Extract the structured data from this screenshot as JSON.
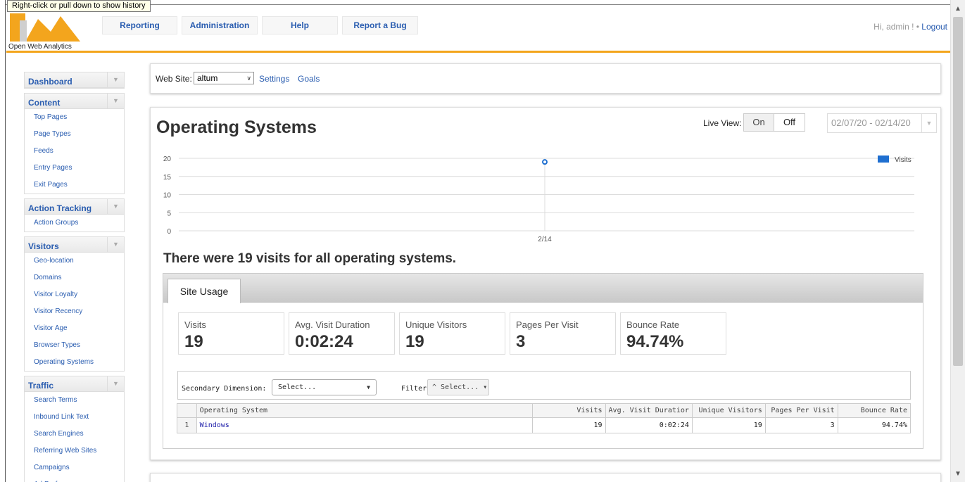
{
  "browser": {
    "tooltip": "Right-click or pull down to show history"
  },
  "header": {
    "logo_text": "Open Web Analytics",
    "nav": [
      {
        "label": "Reporting"
      },
      {
        "label": "Administration"
      },
      {
        "label": "Help"
      },
      {
        "label": "Report a Bug"
      }
    ],
    "greeting": "Hi, admin ! •",
    "logout": "Logout"
  },
  "sidebar": {
    "groups": [
      {
        "title": "Dashboard",
        "items": []
      },
      {
        "title": "Content",
        "items": [
          "Top Pages",
          "Page Types",
          "Feeds",
          "Entry Pages",
          "Exit Pages"
        ]
      },
      {
        "title": "Action Tracking",
        "items": [
          "Action Groups"
        ]
      },
      {
        "title": "Visitors",
        "items": [
          "Geo-location",
          "Domains",
          "Visitor Loyalty",
          "Visitor Recency",
          "Visitor Age",
          "Browser Types",
          "Operating Systems"
        ]
      },
      {
        "title": "Traffic",
        "items": [
          "Search Terms",
          "Inbound Link Text",
          "Search Engines",
          "Referring Web Sites",
          "Campaigns",
          "Ad Performance"
        ]
      }
    ]
  },
  "site_bar": {
    "label": "Web Site:",
    "selected": "altum",
    "settings": "Settings",
    "goals": "Goals"
  },
  "report": {
    "title": "Operating Systems",
    "live_view_label": "Live View:",
    "live_on": "On",
    "live_off": "Off",
    "date_range": "02/07/20 - 02/14/20",
    "summary": "There were 19 visits for all operating systems."
  },
  "chart_data": {
    "type": "line",
    "x": [
      "2/14"
    ],
    "series": [
      {
        "name": "Visits",
        "values": [
          19
        ]
      }
    ],
    "yticks": [
      0,
      5,
      10,
      15,
      20
    ],
    "ylim": [
      0,
      20
    ],
    "grid": true,
    "legend": "top-right",
    "color": "#1f6fd0"
  },
  "site_usage": {
    "tab": "Site Usage",
    "metrics": [
      {
        "label": "Visits",
        "value": "19"
      },
      {
        "label": "Avg. Visit Duration",
        "value": "0:02:24"
      },
      {
        "label": "Unique Visitors",
        "value": "19"
      },
      {
        "label": "Pages Per Visit",
        "value": "3"
      },
      {
        "label": "Bounce Rate",
        "value": "94.74%"
      }
    ]
  },
  "table": {
    "secondary_label": "Secondary Dimension:",
    "secondary_value": "Select...",
    "filter_label": "Filter:",
    "filter_value": "^ Select... ▾",
    "columns": [
      "Operating System",
      "Visits",
      "Avg. Visit Duratior",
      "Unique Visitors",
      "Pages Per Visit",
      "Bounce Rate"
    ],
    "rows": [
      {
        "n": "1",
        "os": "Windows",
        "visits": "19",
        "duration": "0:02:24",
        "unique": "19",
        "ppv": "3",
        "bounce": "94.74%"
      }
    ]
  }
}
